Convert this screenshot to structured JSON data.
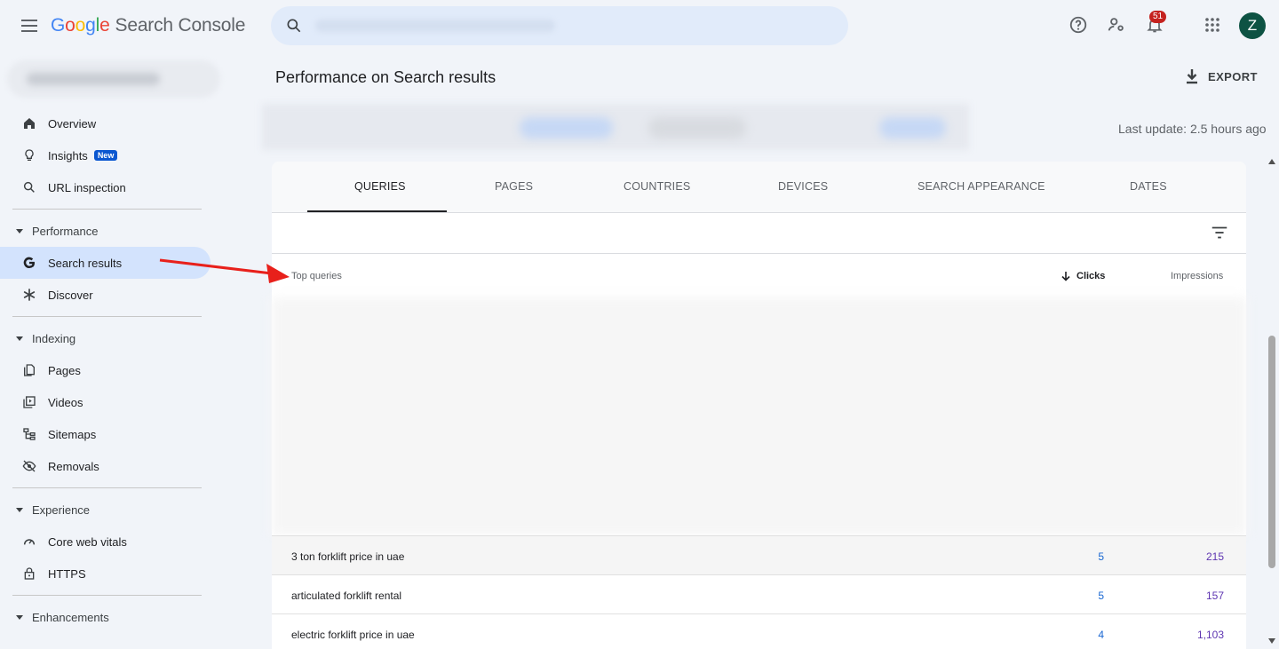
{
  "app": {
    "title_parts": [
      "G",
      "o",
      "o",
      "g",
      "l",
      "e"
    ],
    "product": "Search Console",
    "notification_count": "51",
    "avatar_letter": "Z"
  },
  "sidebar": {
    "items": [
      {
        "label": "Overview",
        "icon": "home-icon"
      },
      {
        "label": "Insights",
        "icon": "lightbulb-icon",
        "badge": "New"
      },
      {
        "label": "URL inspection",
        "icon": "search-icon"
      }
    ],
    "performance": {
      "title": "Performance",
      "items": [
        {
          "label": "Search results",
          "icon": "google-g-icon"
        },
        {
          "label": "Discover",
          "icon": "asterisk-icon"
        }
      ]
    },
    "indexing": {
      "title": "Indexing",
      "items": [
        {
          "label": "Pages",
          "icon": "pages-icon"
        },
        {
          "label": "Videos",
          "icon": "video-icon"
        },
        {
          "label": "Sitemaps",
          "icon": "sitemap-icon"
        },
        {
          "label": "Removals",
          "icon": "eye-off-icon"
        }
      ]
    },
    "experience": {
      "title": "Experience",
      "items": [
        {
          "label": "Core web vitals",
          "icon": "gauge-icon"
        },
        {
          "label": "HTTPS",
          "icon": "lock-icon"
        }
      ]
    },
    "enhancements": {
      "title": "Enhancements"
    }
  },
  "main": {
    "title": "Performance on Search results",
    "export_label": "EXPORT",
    "last_update": "Last update: 2.5 hours ago",
    "tabs": [
      "QUERIES",
      "PAGES",
      "COUNTRIES",
      "DEVICES",
      "SEARCH APPEARANCE",
      "DATES"
    ],
    "active_tab": "QUERIES",
    "table": {
      "headers": {
        "query": "Top queries",
        "clicks": "Clicks",
        "impressions": "Impressions"
      },
      "rows": [
        {
          "query": "3 ton forklift price in uae",
          "clicks": "5",
          "impressions": "215"
        },
        {
          "query": "articulated forklift rental",
          "clicks": "5",
          "impressions": "157"
        },
        {
          "query": "electric forklift price in uae",
          "clicks": "4",
          "impressions": "1,103"
        }
      ]
    }
  },
  "colors": {
    "accent": "#0b57d0",
    "active_nav": "#d3e3fd",
    "clicks": "#1967d2",
    "impressions": "#5e35b1",
    "annotation_arrow": "#e8201b"
  }
}
